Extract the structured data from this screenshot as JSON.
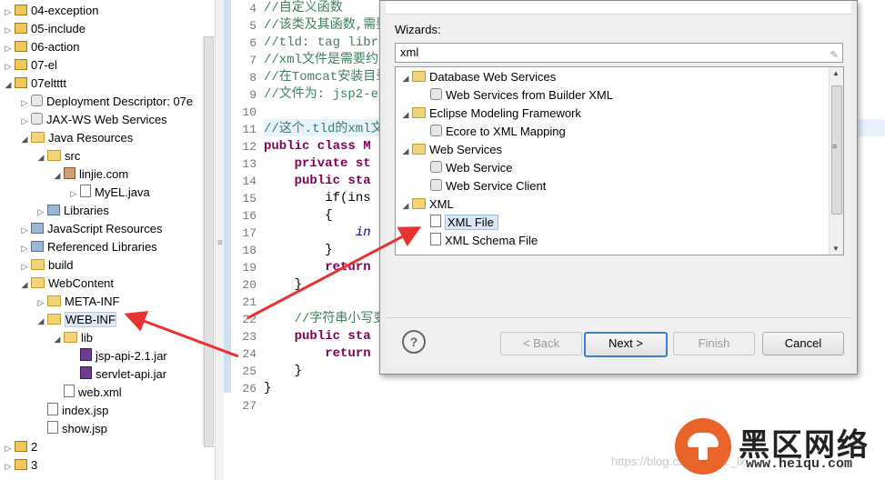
{
  "explorer": {
    "items": [
      {
        "label": "04-exception",
        "depth": 0,
        "expanded": false,
        "icon": "project"
      },
      {
        "label": "05-include",
        "depth": 0,
        "expanded": false,
        "icon": "project"
      },
      {
        "label": "06-action",
        "depth": 0,
        "expanded": false,
        "icon": "project"
      },
      {
        "label": "07-el",
        "depth": 0,
        "expanded": false,
        "icon": "project"
      },
      {
        "label": "07eltttt",
        "depth": 0,
        "expanded": true,
        "icon": "project"
      },
      {
        "label": "Deployment Descriptor: 07e",
        "depth": 1,
        "expanded": false,
        "icon": "descriptor"
      },
      {
        "label": "JAX-WS Web Services",
        "depth": 1,
        "expanded": false,
        "icon": "gear"
      },
      {
        "label": "Java Resources",
        "depth": 1,
        "expanded": true,
        "icon": "folder"
      },
      {
        "label": "src",
        "depth": 2,
        "expanded": true,
        "icon": "folder"
      },
      {
        "label": "linjie.com",
        "depth": 3,
        "expanded": true,
        "icon": "package"
      },
      {
        "label": "MyEL.java",
        "depth": 4,
        "expanded": false,
        "icon": "java-file"
      },
      {
        "label": "Libraries",
        "depth": 2,
        "expanded": false,
        "icon": "library"
      },
      {
        "label": "JavaScript Resources",
        "depth": 1,
        "expanded": false,
        "icon": "library"
      },
      {
        "label": "Referenced Libraries",
        "depth": 1,
        "expanded": false,
        "icon": "library"
      },
      {
        "label": "build",
        "depth": 1,
        "expanded": false,
        "icon": "folder"
      },
      {
        "label": "WebContent",
        "depth": 1,
        "expanded": true,
        "icon": "folder"
      },
      {
        "label": "META-INF",
        "depth": 2,
        "expanded": false,
        "icon": "folder"
      },
      {
        "label": "WEB-INF",
        "depth": 2,
        "expanded": true,
        "icon": "folder",
        "selected": true
      },
      {
        "label": "lib",
        "depth": 3,
        "expanded": true,
        "icon": "folder"
      },
      {
        "label": "jsp-api-2.1.jar",
        "depth": 4,
        "expanded": null,
        "icon": "jar"
      },
      {
        "label": "servlet-api.jar",
        "depth": 4,
        "expanded": null,
        "icon": "jar"
      },
      {
        "label": "web.xml",
        "depth": 3,
        "expanded": null,
        "icon": "xml-file"
      },
      {
        "label": "index.jsp",
        "depth": 2,
        "expanded": null,
        "icon": "file"
      },
      {
        "label": "show.jsp",
        "depth": 2,
        "expanded": null,
        "icon": "file"
      },
      {
        "label": "2",
        "depth": 0,
        "expanded": false,
        "icon": "project"
      },
      {
        "label": "3",
        "depth": 0,
        "expanded": false,
        "icon": "project"
      }
    ]
  },
  "editor": {
    "lines": [
      {
        "n": "4",
        "text": "//自定义函数",
        "style": "cm"
      },
      {
        "n": "5",
        "text": "//该类及其函数,需要和",
        "style": "cm"
      },
      {
        "n": "6",
        "text": "//tld: tag libr",
        "style": "cm"
      },
      {
        "n": "7",
        "text": "//xml文件是需要约束",
        "style": "cm"
      },
      {
        "n": "8",
        "text": "//在Tomcat安装目录",
        "style": "cm"
      },
      {
        "n": "9",
        "text": "//文件为: jsp2-ex",
        "style": "cm"
      },
      {
        "n": "10",
        "text": "",
        "style": ""
      },
      {
        "n": "11",
        "text": "//这个.tld的xml文",
        "style": "cm"
      },
      {
        "n": "12",
        "text": "public class M",
        "style": "kw"
      },
      {
        "n": "13",
        "text": "    private st",
        "style": "kw"
      },
      {
        "n": "14",
        "text": "    public sta",
        "style": "kw"
      },
      {
        "n": "15",
        "text": "        if(ins",
        "style": "if"
      },
      {
        "n": "16",
        "text": "        {",
        "style": ""
      },
      {
        "n": "17",
        "text": "            in",
        "style": "it"
      },
      {
        "n": "18",
        "text": "        }",
        "style": ""
      },
      {
        "n": "19",
        "text": "        return",
        "style": "kw"
      },
      {
        "n": "20",
        "text": "    }",
        "style": ""
      },
      {
        "n": "21",
        "text": "",
        "style": ""
      },
      {
        "n": "22",
        "text": "    //字符串小写变",
        "style": "cm"
      },
      {
        "n": "23",
        "text": "    public sta",
        "style": "kw"
      },
      {
        "n": "24",
        "text": "        return",
        "style": "kw"
      },
      {
        "n": "25",
        "text": "    }",
        "style": ""
      },
      {
        "n": "26",
        "text": "}",
        "style": ""
      },
      {
        "n": "27",
        "text": "",
        "style": ""
      }
    ]
  },
  "dialog": {
    "wizards_label": "Wizards:",
    "filter_value": "xml",
    "tree": [
      {
        "label": "Database Web Services",
        "depth": 0,
        "expanded": true,
        "icon": "folder"
      },
      {
        "label": "Web Services from Builder XML",
        "depth": 1,
        "icon": "wizard"
      },
      {
        "label": "Eclipse Modeling Framework",
        "depth": 0,
        "expanded": true,
        "icon": "folder"
      },
      {
        "label": "Ecore to XML Mapping",
        "depth": 1,
        "icon": "wizard"
      },
      {
        "label": "Web Services",
        "depth": 0,
        "expanded": true,
        "icon": "folder"
      },
      {
        "label": "Web Service",
        "depth": 1,
        "icon": "wizard"
      },
      {
        "label": "Web Service Client",
        "depth": 1,
        "icon": "wizard"
      },
      {
        "label": "XML",
        "depth": 0,
        "expanded": true,
        "icon": "folder"
      },
      {
        "label": "XML File",
        "depth": 1,
        "icon": "xml-file",
        "selected": true
      },
      {
        "label": "XML Schema File",
        "depth": 1,
        "icon": "xml-file"
      }
    ],
    "buttons": {
      "help": "?",
      "back": "< Back",
      "next": "Next >",
      "finish": "Finish",
      "cancel": "Cancel"
    }
  },
  "watermark": {
    "title": "黑区网络",
    "url": "www.heiqu.com",
    "faint": "https://blog.csdn.net/..._lx"
  },
  "colors": {
    "arrow": "#e8322f",
    "selection": "#dde8f5",
    "keyword": "#7f0055",
    "comment": "#3f7f5f",
    "default_button_border": "#3c7fd0"
  }
}
